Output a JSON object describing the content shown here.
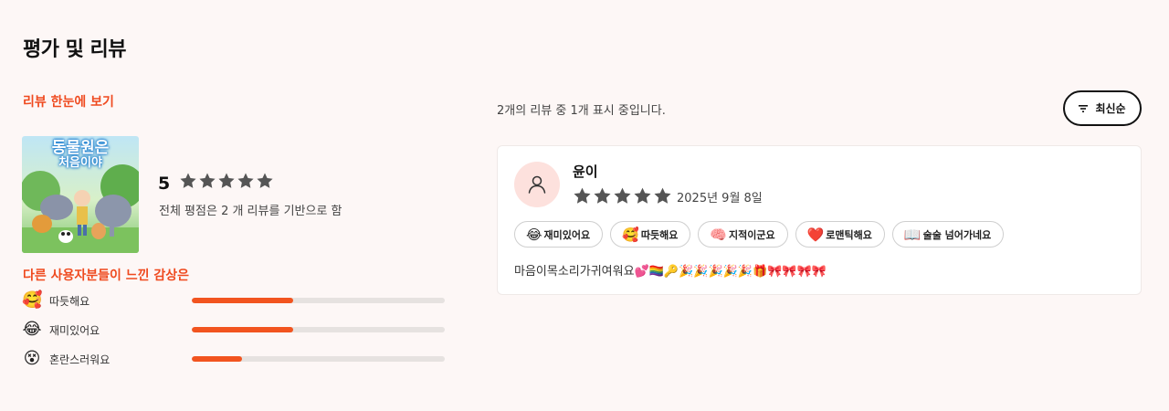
{
  "page": {
    "title": "평가 및 리뷰"
  },
  "glance": {
    "title": "리뷰 한눈에 보기",
    "cover_line1": "동물원은",
    "cover_line2": "처음이야",
    "rating": "5",
    "stars": 5,
    "description": "전체 평점은 2 개 리뷰를 기반으로 함"
  },
  "feelings": {
    "title": "다른 사용자분들이 느낀 감상은",
    "items": [
      {
        "emoji": "🥰",
        "label": "따듯해요",
        "fraction": 0.4
      },
      {
        "emoji": "😂",
        "label": "재미있어요",
        "fraction": 0.4
      },
      {
        "emoji": "😵",
        "label": "혼란스러워요",
        "fraction": 0.2
      }
    ]
  },
  "reviews_header": {
    "count_text": "2개의 리뷰 중 1개 표시 중입니다.",
    "sort_label": "최신순",
    "sort_icon": "filter-icon"
  },
  "review": {
    "avatar_icon": "user-icon",
    "name": "윤이",
    "stars": 5,
    "date": "2025년 9월 8일",
    "tags": [
      {
        "emoji": "😂",
        "label": "재미있어요"
      },
      {
        "emoji": "🥰",
        "label": "따듯해요"
      },
      {
        "emoji": "🧠",
        "label": "지적이군요"
      },
      {
        "emoji": "❤️",
        "label": "로맨틱해요"
      },
      {
        "emoji": "📖",
        "label": "술술 넘어가네요"
      }
    ],
    "text": "마음이목소리가귀여워요💕🏳️‍🌈🔑🎉🎉🎉🎉🎉🎁🎀🎀🎀🎀"
  },
  "colors": {
    "accent": "#ef4a1f",
    "bar_fill": "#f2541f",
    "star": "#555555",
    "background": "#fdf7f6",
    "avatar_bg": "#fde1dd"
  }
}
